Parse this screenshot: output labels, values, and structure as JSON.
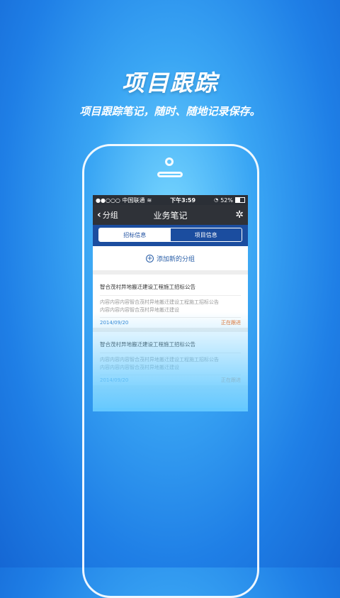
{
  "promo": {
    "title": "项目跟踪",
    "subtitle": "项目跟踪笔记，随时、随地记录保存。"
  },
  "status_bar": {
    "carrier": "●●○○○ 中国联通",
    "time": "下午3:59",
    "battery": "52%"
  },
  "nav": {
    "back_label": "分组",
    "title": "业务笔记"
  },
  "tabs": [
    {
      "label": "招标信息"
    },
    {
      "label": "项目信息"
    }
  ],
  "add_group": {
    "label": "添加新的分组"
  },
  "notes": [
    {
      "title": "智合茂村异地搬迁建设工程施工招标公告",
      "line1": "内容内容内容智合茂村异地搬迁建设工程施工招标公告",
      "line2": "内容内容内容智合茂村异地搬迁建设",
      "date": "2014/09/20",
      "status": "正在跟进"
    },
    {
      "title": "智合茂村异地搬迁建设工程施工招标公告",
      "line1": "内容内容内容智合茂村异地搬迁建设工程施工招标公告",
      "line2": "内容内容内容智合茂村异地搬迁建设",
      "date": "2014/09/20",
      "status": "正在跟进"
    }
  ]
}
